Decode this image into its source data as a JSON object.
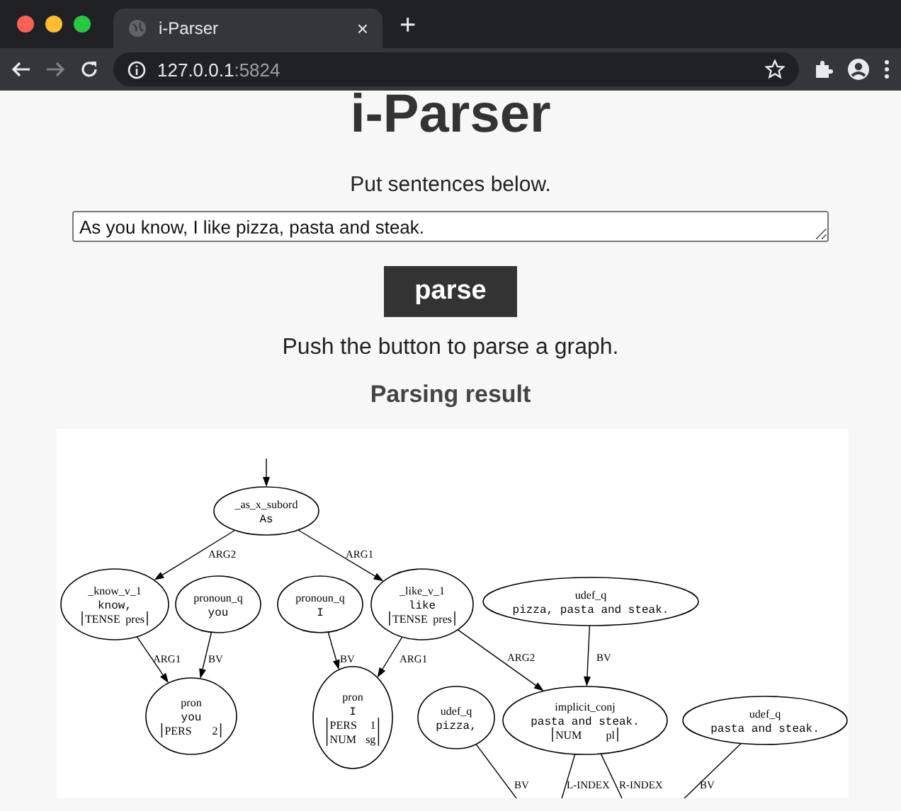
{
  "browser": {
    "tab": {
      "title": "i-Parser",
      "close": "×",
      "selected": true
    },
    "new_tab": "+",
    "address": {
      "host": "127.0.0.1",
      "port": ":5824"
    }
  },
  "page": {
    "heading": "i-Parser",
    "prompt": "Put sentences below.",
    "input": {
      "value": "As you know, I like pizza, pasta and steak."
    },
    "button": "parse",
    "hint": "Push the button to parse a graph.",
    "result_title": "Parsing result"
  },
  "graph": {
    "nodes": [
      {
        "lines": [
          {
            "kind": "pred",
            "text": "_as_x_subord"
          },
          {
            "kind": "surface",
            "text": "As"
          }
        ]
      },
      {
        "lines": [
          {
            "kind": "pred",
            "text": "_know_v_1"
          },
          {
            "kind": "surface",
            "text": "know,"
          },
          {
            "kind": "attr",
            "name": "TENSE",
            "value": "pres"
          }
        ]
      },
      {
        "lines": [
          {
            "kind": "pred",
            "text": "pronoun_q"
          },
          {
            "kind": "surface",
            "text": "you"
          }
        ]
      },
      {
        "lines": [
          {
            "kind": "pred",
            "text": "pronoun_q"
          },
          {
            "kind": "surface",
            "text": "I"
          }
        ]
      },
      {
        "lines": [
          {
            "kind": "pred",
            "text": "_like_v_1"
          },
          {
            "kind": "surface",
            "text": "like"
          },
          {
            "kind": "attr",
            "name": "TENSE",
            "value": "pres"
          }
        ]
      },
      {
        "lines": [
          {
            "kind": "pred",
            "text": "udef_q"
          },
          {
            "kind": "surface",
            "text": "pizza, pasta and steak."
          }
        ]
      },
      {
        "lines": [
          {
            "kind": "pred",
            "text": "pron"
          },
          {
            "kind": "surface",
            "text": "you"
          },
          {
            "kind": "attr",
            "name": "PERS",
            "value": "2"
          }
        ]
      },
      {
        "lines": [
          {
            "kind": "pred",
            "text": "pron"
          },
          {
            "kind": "surface",
            "text": "I"
          },
          {
            "kind": "attr",
            "name": "PERS",
            "value": "1"
          },
          {
            "kind": "attr",
            "name": "NUM",
            "value": "sg"
          }
        ]
      },
      {
        "lines": [
          {
            "kind": "pred",
            "text": "udef_q"
          },
          {
            "kind": "surface",
            "text": "pizza,"
          }
        ]
      },
      {
        "lines": [
          {
            "kind": "pred",
            "text": "implicit_conj"
          },
          {
            "kind": "surface",
            "text": "pasta and steak."
          },
          {
            "kind": "attr",
            "name": "NUM",
            "value": "pl"
          }
        ]
      },
      {
        "lines": [
          {
            "kind": "pred",
            "text": "udef_q"
          },
          {
            "kind": "surface",
            "text": "pasta and steak."
          }
        ]
      }
    ],
    "edges": [
      {
        "label": "ARG2"
      },
      {
        "label": "ARG1"
      },
      {
        "label": "ARG1"
      },
      {
        "label": "BV"
      },
      {
        "label": "BV"
      },
      {
        "label": "ARG1"
      },
      {
        "label": "ARG2"
      },
      {
        "label": "BV"
      },
      {
        "label": "BV"
      },
      {
        "label": "L-INDEX"
      },
      {
        "label": "R-INDEX"
      },
      {
        "label": "BV"
      }
    ]
  }
}
